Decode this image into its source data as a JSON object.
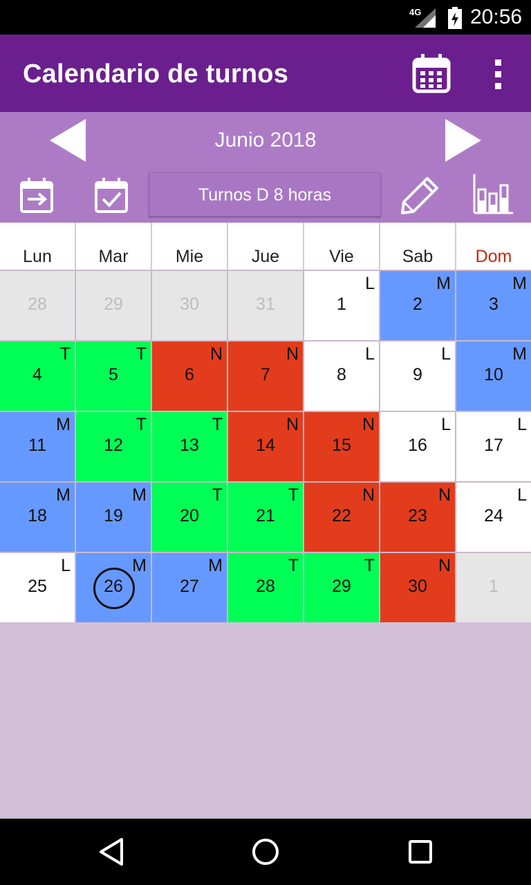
{
  "status": {
    "network": "4G",
    "time": "20:56"
  },
  "appbar": {
    "title": "Calendario de turnos",
    "calendar_icon": "calendar-icon",
    "menu_icon": "more-vert-icon"
  },
  "nav": {
    "month": "Junio 2018",
    "prev_icon": "triangle-left-icon",
    "next_icon": "triangle-right-icon"
  },
  "toolbar": {
    "shift_pattern": "Turnos D 8 horas",
    "icons": [
      "calendar-export-icon",
      "calendar-check-icon",
      "pencil-icon",
      "bar-chart-icon"
    ]
  },
  "weekdays": [
    "Lun",
    "Mar",
    "Mie",
    "Jue",
    "Vie",
    "Sab",
    "Dom"
  ],
  "colors": {
    "M": "#6699ff",
    "T": "#00ff55",
    "N": "#e23c1c",
    "L": "#ffffff",
    "muted": "#e6e6e6",
    "sunday": "#c0290e"
  },
  "weeks": [
    [
      {
        "day": "28",
        "shift": "",
        "muted": true
      },
      {
        "day": "29",
        "shift": "",
        "muted": true
      },
      {
        "day": "30",
        "shift": "",
        "muted": true
      },
      {
        "day": "31",
        "shift": "",
        "muted": true
      },
      {
        "day": "1",
        "shift": "L"
      },
      {
        "day": "2",
        "shift": "M"
      },
      {
        "day": "3",
        "shift": "M"
      }
    ],
    [
      {
        "day": "4",
        "shift": "T"
      },
      {
        "day": "5",
        "shift": "T"
      },
      {
        "day": "6",
        "shift": "N"
      },
      {
        "day": "7",
        "shift": "N"
      },
      {
        "day": "8",
        "shift": "L"
      },
      {
        "day": "9",
        "shift": "L"
      },
      {
        "day": "10",
        "shift": "M"
      }
    ],
    [
      {
        "day": "11",
        "shift": "M"
      },
      {
        "day": "12",
        "shift": "T"
      },
      {
        "day": "13",
        "shift": "T"
      },
      {
        "day": "14",
        "shift": "N"
      },
      {
        "day": "15",
        "shift": "N"
      },
      {
        "day": "16",
        "shift": "L"
      },
      {
        "day": "17",
        "shift": "L"
      }
    ],
    [
      {
        "day": "18",
        "shift": "M"
      },
      {
        "day": "19",
        "shift": "M"
      },
      {
        "day": "20",
        "shift": "T"
      },
      {
        "day": "21",
        "shift": "T"
      },
      {
        "day": "22",
        "shift": "N"
      },
      {
        "day": "23",
        "shift": "N"
      },
      {
        "day": "24",
        "shift": "L"
      }
    ],
    [
      {
        "day": "25",
        "shift": "L"
      },
      {
        "day": "26",
        "shift": "M",
        "today": true
      },
      {
        "day": "27",
        "shift": "M"
      },
      {
        "day": "28",
        "shift": "T"
      },
      {
        "day": "29",
        "shift": "T"
      },
      {
        "day": "30",
        "shift": "N"
      },
      {
        "day": "1",
        "shift": "",
        "muted": true
      }
    ]
  ],
  "navbar": {
    "icons": [
      "back-icon",
      "home-icon",
      "recents-icon"
    ]
  }
}
